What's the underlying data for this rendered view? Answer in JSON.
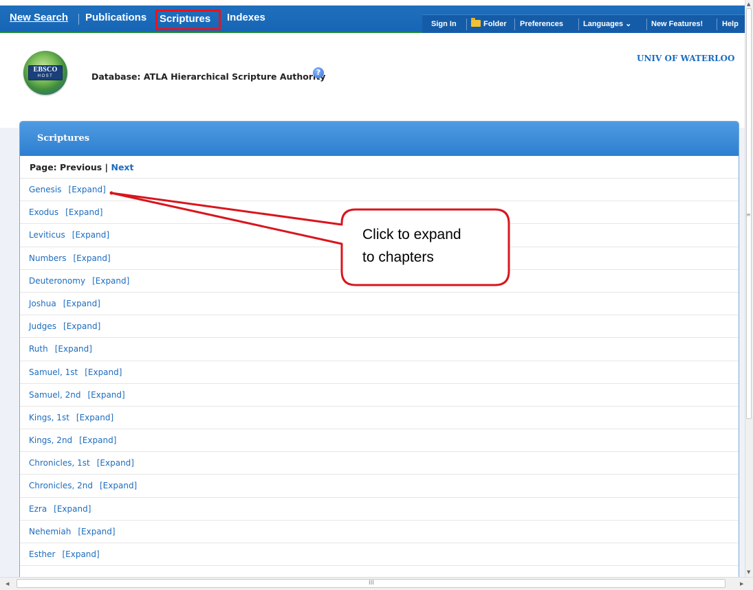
{
  "nav": {
    "tabs": [
      "New Search",
      "Publications",
      "Scriptures",
      "Indexes"
    ],
    "right": {
      "sign_in": "Sign In",
      "folder": "Folder",
      "preferences": "Preferences",
      "languages": "Languages",
      "languages_chevron": "⌄",
      "new_features": "New Features!",
      "help": "Help"
    }
  },
  "header": {
    "logo_line1": "EBSCO",
    "logo_line2": "HOST",
    "database_label": "Database: ATLA Hierarchical Scripture Authority",
    "help_icon_glyph": "?",
    "institution": "UNIV OF WATERLOO"
  },
  "panel": {
    "title": "Scriptures",
    "pager_label": "Page: Previous | ",
    "pager_next": "Next",
    "expand_label": "[Expand]",
    "books": [
      "Genesis",
      "Exodus",
      "Leviticus",
      "Numbers",
      "Deuteronomy",
      "Joshua",
      "Judges",
      "Ruth",
      "Samuel, 1st",
      "Samuel, 2nd",
      "Kings, 1st",
      "Kings, 2nd",
      "Chronicles, 1st",
      "Chronicles, 2nd",
      "Ezra",
      "Nehemiah",
      "Esther"
    ]
  },
  "callout": {
    "line1": "Click to expand",
    "line2": "to chapters"
  },
  "scrollbar": {
    "h_grip": "III",
    "v_grip": "≡",
    "left_arrow": "◀",
    "right_arrow": "▶",
    "up_arrow": "▲",
    "down_arrow": "▼"
  },
  "colors": {
    "nav_blue": "#1766b5",
    "link_blue": "#1c6cbf",
    "highlight_red": "#e8141c",
    "panel_head": "#2d7fd0"
  }
}
